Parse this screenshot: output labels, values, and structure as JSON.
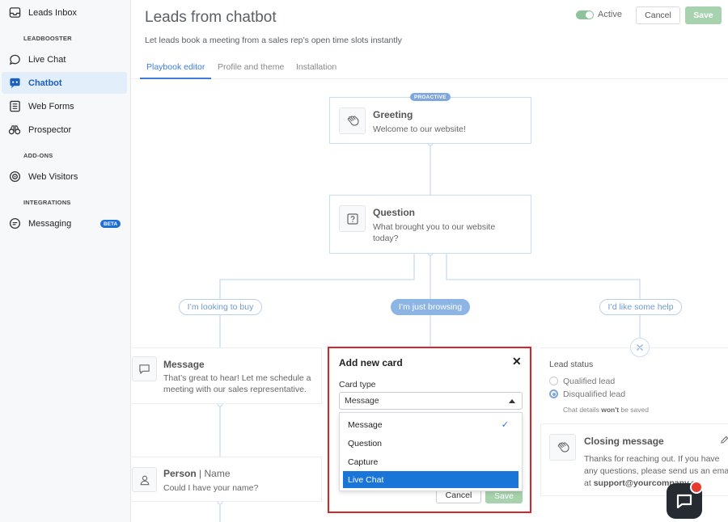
{
  "sidebar": {
    "items": [
      {
        "label": "Leads Inbox",
        "icon": "inbox-icon"
      },
      {
        "label": "Live Chat",
        "icon": "chat-icon"
      },
      {
        "label": "Chatbot",
        "icon": "chatbot-icon"
      },
      {
        "label": "Web Forms",
        "icon": "form-icon"
      },
      {
        "label": "Prospector",
        "icon": "binoculars-icon"
      },
      {
        "label": "Web Visitors",
        "icon": "target-icon"
      },
      {
        "label": "Messaging",
        "icon": "message-icon"
      }
    ],
    "sections": {
      "leadbooster": "LEADBOOSTER",
      "addons": "ADD-ONS",
      "integrations": "INTEGRATIONS"
    },
    "beta_badge": "BETA",
    "active_item": "Chatbot"
  },
  "header": {
    "title": "Leads from chatbot",
    "subtitle": "Let leads book a meeting from a sales rep’s open time slots instantly",
    "active_label": "Active",
    "cancel_label": "Cancel",
    "save_label": "Save"
  },
  "tabs": [
    {
      "label": "Playbook editor",
      "active": true
    },
    {
      "label": "Profile and theme",
      "active": false
    },
    {
      "label": "Installation",
      "active": false
    }
  ],
  "flow": {
    "proactive_badge": "PROACTIVE",
    "greeting": {
      "title": "Greeting",
      "text": "Welcome to our website!"
    },
    "question": {
      "title": "Question",
      "text_line1": "What brought you to our website",
      "text_line2": "today?"
    },
    "options": [
      "I’m looking to buy",
      "I’m just browsing",
      "I’d like some help"
    ],
    "message": {
      "title": "Message",
      "text_line1": "That’s great to hear! Let me schedule a",
      "text_line2": "meeting with our sales representative."
    },
    "person": {
      "title": "Person",
      "title_suffix": "| Name",
      "text": "Could I have your name?"
    },
    "closing": {
      "title": "Closing message",
      "text_line1": "Thanks for reaching out. If you have",
      "text_line2": "any questions, please send us an email",
      "text_line3_prefix": "at ",
      "text_line3_email": "support@yourcompany.co"
    }
  },
  "modal": {
    "title": "Add new card",
    "close_symbol": "✕",
    "card_type_label": "Card type",
    "selected_value": "Message",
    "options": [
      {
        "label": "Message",
        "checked": true,
        "highlighted": false
      },
      {
        "label": "Question",
        "checked": false,
        "highlighted": false
      },
      {
        "label": "Capture",
        "checked": false,
        "highlighted": false
      },
      {
        "label": "Live Chat",
        "checked": false,
        "highlighted": true
      }
    ],
    "cancel_label": "Cancel",
    "save_label": "Save"
  },
  "lead_status": {
    "label": "Lead status",
    "options": [
      {
        "label": "Qualified lead",
        "selected": false
      },
      {
        "label": "Disqualified lead",
        "selected": true
      }
    ],
    "note_prefix": "Chat details ",
    "note_bold": "won't",
    "note_suffix": " be saved"
  },
  "colors": {
    "accent": "#3b7dd8",
    "save_green": "#a7d2ae",
    "highlight_red": "#d9252a",
    "dropdown_selected": "#1a75d9"
  }
}
